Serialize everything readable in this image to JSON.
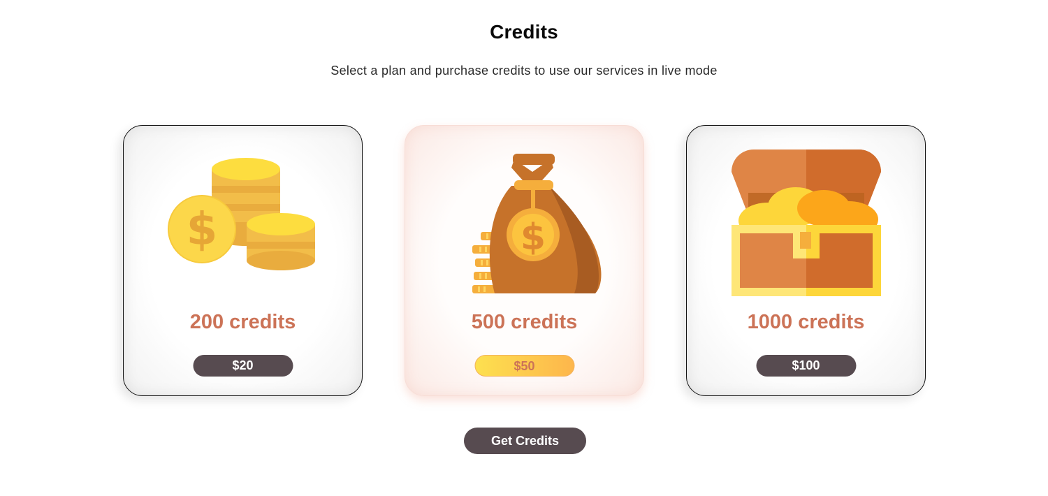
{
  "header": {
    "title": "Credits",
    "subtitle": "Select a plan and purchase credits to use our services in live mode"
  },
  "plans": [
    {
      "credits_label": "200 credits",
      "price_label": "$20",
      "icon": "coins-stack-icon",
      "selected": false
    },
    {
      "credits_label": "500 credits",
      "price_label": "$50",
      "icon": "money-bag-icon",
      "selected": true
    },
    {
      "credits_label": "1000 credits",
      "price_label": "$100",
      "icon": "treasure-chest-icon",
      "selected": false
    }
  ],
  "actions": {
    "get_credits_label": "Get Credits"
  },
  "colors": {
    "accent_text": "#cc7357",
    "dark_button": "#574b50",
    "gold_gradient_start": "#fde04f",
    "gold_gradient_end": "#fdb64c"
  }
}
